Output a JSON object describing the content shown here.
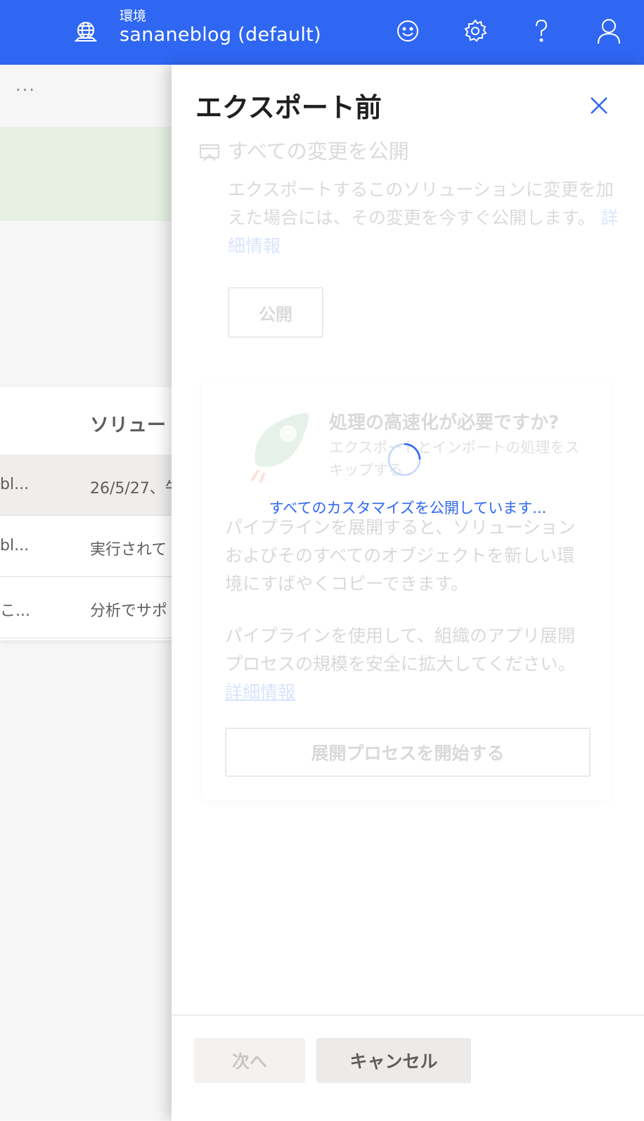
{
  "topbar": {
    "env_label": "環境",
    "env_name": "sananeblog (default)",
    "icons": [
      "globe-icon",
      "smiley-icon",
      "gear-icon",
      "help-icon",
      "user-icon"
    ]
  },
  "background": {
    "more": "···",
    "table_header": "ソリュー",
    "rows": [
      {
        "c1": "bl...",
        "c2": "26/5/27、午"
      },
      {
        "c1": "bl...",
        "c2": "実行されて"
      },
      {
        "c1": "こ...",
        "c2": "分析でサポ"
      }
    ]
  },
  "panel": {
    "title": "エクスポート前",
    "publish_section": {
      "title": "すべての変更を公開",
      "description": "エクスポートするこのソリューションに変更を加えた場合には、その変更を今すぐ公開します。",
      "link": "詳細情報",
      "button": "公開"
    },
    "promo": {
      "title": "処理の高速化が必要ですか?",
      "subtitle": "エクスポートとインポートの処理をスキップする",
      "desc1": "パイプラインを展開すると、ソリューションおよびそのすべてのオブジェクトを新しい環境にすばやくコピーできます。",
      "desc2": "パイプラインを使用して、組織のアプリ展開プロセスの規模を安全に拡大してください。",
      "link": "詳細情報",
      "button": "展開プロセスを開始する"
    },
    "loading_text": "すべてのカスタマイズを公開しています...",
    "footer": {
      "next": "次へ",
      "cancel": "キャンセル"
    }
  },
  "colors": {
    "accent": "#2f67f3",
    "banner": "#e6f1e4"
  }
}
